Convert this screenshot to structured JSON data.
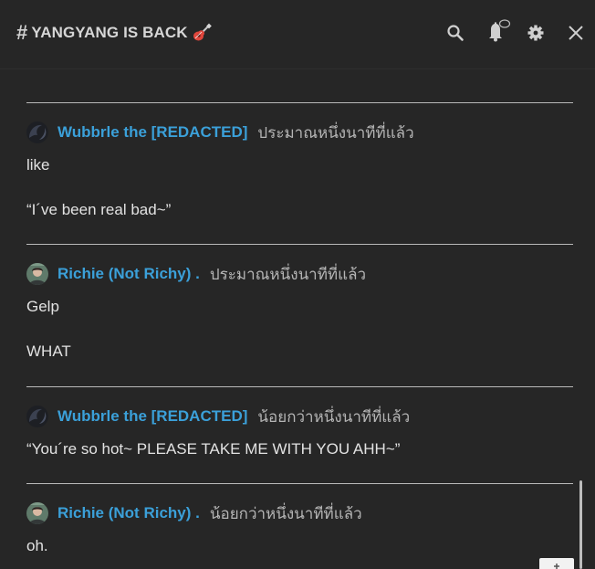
{
  "header": {
    "title": "YANGYANG IS BACK",
    "icons": [
      "search-icon",
      "bell-icon",
      "gear-icon",
      "close-icon"
    ]
  },
  "messages": [
    {
      "author": "Wubbrle the [REDACTED]",
      "time": "ประมาณหนึ่งนาทีที่แล้ว",
      "lines": [
        "like",
        "“I´ve been real bad~”"
      ]
    },
    {
      "author": "Richie (Not Richy) .",
      "time": "ประมาณหนึ่งนาทีที่แล้ว",
      "lines": [
        "Gelp",
        "WHAT"
      ]
    },
    {
      "author": "Wubbrle the [REDACTED]",
      "time": "น้อยกว่าหนึ่งนาทีที่แล้ว",
      "lines": [
        "“You´re so hot~ PLEASE TAKE ME WITH YOU AHH~”"
      ]
    },
    {
      "author": "Richie (Not Richy) .",
      "time": "น้อยกว่าหนึ่งนาทีที่แล้ว",
      "lines": [
        "oh."
      ]
    }
  ],
  "colors": {
    "background": "#262626",
    "author": "#3ba0d9",
    "timestamp": "#b5b5b5",
    "message_text": "#e2e2e2",
    "separator": "#b9b9b9"
  }
}
